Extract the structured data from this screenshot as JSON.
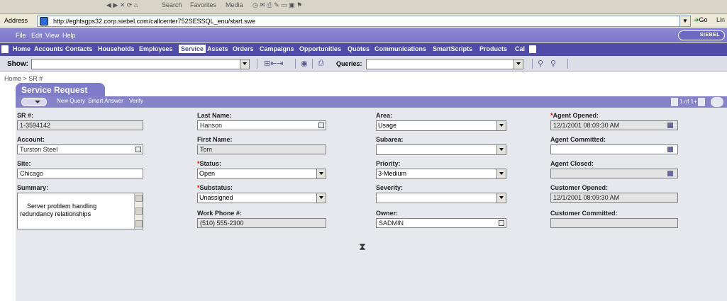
{
  "ie": {
    "toolbar_search": "Search",
    "toolbar_favorites": "Favorites",
    "toolbar_media": "Media",
    "address_label": "Address",
    "url": "http://eghtsgps32.corp.siebel.com/callcenter752SESSQL_enu/start.swe",
    "go_label": "Go",
    "links_label": "Lin"
  },
  "siebel": {
    "menu": [
      "File",
      "Edit",
      "View",
      "Help"
    ],
    "logo_text": "SIEBEL",
    "tabs": [
      "Home",
      "Accounts",
      "Contacts",
      "Households",
      "Employees",
      "Service",
      "Assets",
      "Orders",
      "Campaigns",
      "Opportunities",
      "Quotes",
      "Communications",
      "SmartScripts",
      "Products",
      "Cal"
    ],
    "active_tab": "Service",
    "show_label": "Show:",
    "show_value": "",
    "queries_label": "Queries:",
    "queries_value": "",
    "breadcrumb": "Home  > SR #"
  },
  "applet": {
    "title": "Service Request",
    "links": [
      "New Query",
      "Smart Answer",
      "Verify"
    ],
    "record_count": "1 of 1+",
    "fields": {
      "sr_label": "SR #:",
      "sr_value": "1-3594142",
      "account_label": "Account:",
      "account_value": "Turston Steel",
      "site_label": "Site:",
      "site_value": "Chicago",
      "summary_label": "Summary:",
      "summary_value": "Server problem handling\nredundancy relationships",
      "last_name_label": "Last Name:",
      "last_name_value": "Hanson",
      "first_name_label": "First Name:",
      "first_name_value": "Tom",
      "status_label": "Status:",
      "status_value": "Open",
      "substatus_label": "Substatus:",
      "substatus_value": "Unassigned",
      "work_phone_label": "Work Phone #:",
      "work_phone_value": "(510) 555-2300",
      "area_label": "Area:",
      "area_value": "Usage",
      "subarea_label": "Subarea:",
      "subarea_value": "",
      "priority_label": "Priority:",
      "priority_value": "3-Medium",
      "severity_label": "Severity:",
      "severity_value": "",
      "owner_label": "Owner:",
      "owner_value": "SADMIN",
      "agent_opened_label": "Agent Opened:",
      "agent_opened_value": "12/1/2001 08:09:30 AM",
      "agent_committed_label": "Agent Committed:",
      "agent_committed_value": "",
      "agent_closed_label": "Agent Closed:",
      "agent_closed_value": "",
      "customer_opened_label": "Customer Opened:",
      "customer_opened_value": "12/1/2001 08:09:30 AM",
      "customer_committed_label": "Customer Committed:",
      "customer_committed_value": ""
    },
    "required_marker": "*"
  }
}
